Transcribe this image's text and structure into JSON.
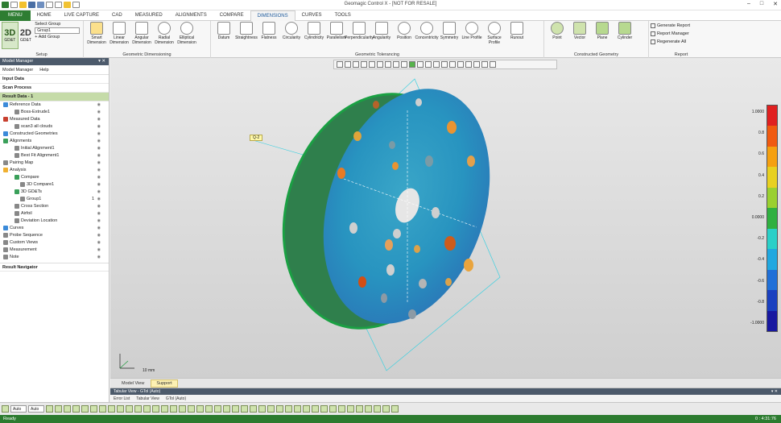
{
  "app": {
    "title": "Geomagic Control X - [NOT FOR RESALE]"
  },
  "tabs": [
    "MENU",
    "HOME",
    "LIVE CAPTURE",
    "CAD",
    "MEASURED",
    "ALIGNMENTS",
    "COMPARE",
    "DIMENSIONS",
    "CURVES",
    "TOOLS"
  ],
  "ribbon": {
    "setup": {
      "label": "Setup",
      "gdt3d_line1": "3D",
      "gdt3d_line2": "GD&T",
      "gdt2d_line1": "2D",
      "gdt2d_line2": "GD&T",
      "select_group_label": "Select Group",
      "select_group_value": "Group1",
      "add_group": "Add Group"
    },
    "geo_dim": {
      "label": "Geometric Dimensioning",
      "items": [
        "Smart Dimension",
        "Linear Dimension",
        "Angular Dimension",
        "Radial Dimension",
        "Elliptical Dimension"
      ]
    },
    "geo_tol": {
      "label": "Geometric Tolerancing",
      "items": [
        "Datum",
        "Straightness",
        "Flatness",
        "Circularity",
        "Cylindricity",
        "Parallelism",
        "Perpendicularity",
        "Angularity",
        "Position",
        "Concentricity",
        "Symmetry",
        "Line Profile",
        "Surface Profile",
        "Runout"
      ]
    },
    "constructed": {
      "label": "Constructed Geometry",
      "items": [
        "Point",
        "Vector",
        "Plane",
        "Cylinder"
      ]
    },
    "report": {
      "label": "Report",
      "items": [
        "Generate Report",
        "Report Manager",
        "Regenerate All"
      ]
    }
  },
  "sidebar": {
    "title": "Model Manager",
    "tabs": [
      "Model Manager",
      "Help"
    ],
    "sections": [
      "Input Data",
      "Scan Process",
      "Result Data - 1"
    ],
    "tree": [
      {
        "label": "Reference Data",
        "indent": 0
      },
      {
        "label": "Boss-Extrude1",
        "indent": 2
      },
      {
        "label": "Measured Data",
        "indent": 0
      },
      {
        "label": "scan3 all clouds",
        "indent": 2
      },
      {
        "label": "Constructed Geometries",
        "indent": 0
      },
      {
        "label": "Alignments",
        "indent": 0
      },
      {
        "label": "Initial Alignment1",
        "indent": 2
      },
      {
        "label": "Best Fit Alignment1",
        "indent": 2
      },
      {
        "label": "Pairing Map",
        "indent": 0
      },
      {
        "label": "Analysis",
        "indent": 0
      },
      {
        "label": "Compare",
        "indent": 2
      },
      {
        "label": "3D Compare1",
        "indent": 3
      },
      {
        "label": "3D GD&Ts",
        "indent": 2
      },
      {
        "label": "Group1",
        "indent": 3,
        "extra": "1"
      },
      {
        "label": "Cross Section",
        "indent": 2
      },
      {
        "label": "Airfoil",
        "indent": 2
      },
      {
        "label": "Deviation Location",
        "indent": 2
      },
      {
        "label": "Curves",
        "indent": 0
      },
      {
        "label": "Probe Sequence",
        "indent": 0
      },
      {
        "label": "Custom Views",
        "indent": 0
      },
      {
        "label": "Measurement",
        "indent": 0
      },
      {
        "label": "Note",
        "indent": 0
      }
    ],
    "result_navigator": "Result Navigator"
  },
  "viewport": {
    "datum_tag": "Q-2",
    "scale_label": "10 mm",
    "colorbar_ticks": [
      "1.0000",
      "0.8",
      "0.6",
      "0.4",
      "0.2",
      "0.0000",
      "-0.2",
      "-0.4",
      "-0.6",
      "-0.8",
      "-1.0000"
    ],
    "colorbar_colors": [
      "#e02020",
      "#f05a10",
      "#f5a010",
      "#e8d020",
      "#9ad030",
      "#30b040",
      "#2ad0c8",
      "#20a8e0",
      "#2070d8",
      "#1a40c0",
      "#1818a0"
    ]
  },
  "view_tabs": [
    "Model View",
    "Support"
  ],
  "tabular": {
    "title": "Tabular View - GTol (Auto)",
    "sub": [
      "Error List",
      "Tabular View",
      "GTol (Auto)"
    ]
  },
  "bottom": {
    "combo1": "Auto",
    "combo2": "Auto"
  },
  "status": {
    "left": "Ready",
    "right": "0 : 4:31:76"
  }
}
